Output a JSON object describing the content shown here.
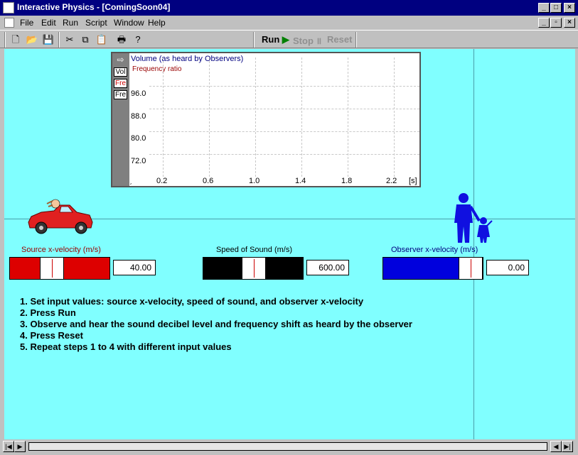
{
  "window": {
    "title": "Interactive Physics - [ComingSoon04]"
  },
  "menu": {
    "items": [
      "File",
      "Edit",
      "Run",
      "Script",
      "Window",
      "Help"
    ]
  },
  "toolbar": {
    "run": "Run",
    "stop": "Stop",
    "reset": "Reset"
  },
  "graph": {
    "rows": [
      "Volume (as heard by Observers)",
      "Frequency ratio"
    ],
    "side_buttons": [
      "Vol",
      "Fre",
      "Fre"
    ],
    "y_ticks": [
      "96.0",
      "88.0",
      "80.0",
      "72.0"
    ],
    "x_ticks": [
      "0.2",
      "0.6",
      "1.0",
      "1.4",
      "1.8",
      "2.2"
    ],
    "x_unit": "[s]"
  },
  "controls": {
    "source": {
      "label": "Source x-velocity (m/s)",
      "value": "40.00",
      "color": "#dd0000",
      "position": 0.43
    },
    "sound": {
      "label": "Speed of Sound (m/s)",
      "value": "600.00",
      "color": "#000000",
      "position": 0.5
    },
    "observer": {
      "label": "Observer x-velocity (m/s)",
      "value": "0.00",
      "color": "#0000dd",
      "position": 0.82
    }
  },
  "instructions": [
    "1. Set input values: source x-velocity, speed of sound, and observer x-velocity",
    "2. Press Run",
    "3. Observe and hear the sound decibel level and frequency shift as heard by the observer",
    "4. Press Reset",
    "5. Repeat steps 1 to 4 with different input values"
  ]
}
